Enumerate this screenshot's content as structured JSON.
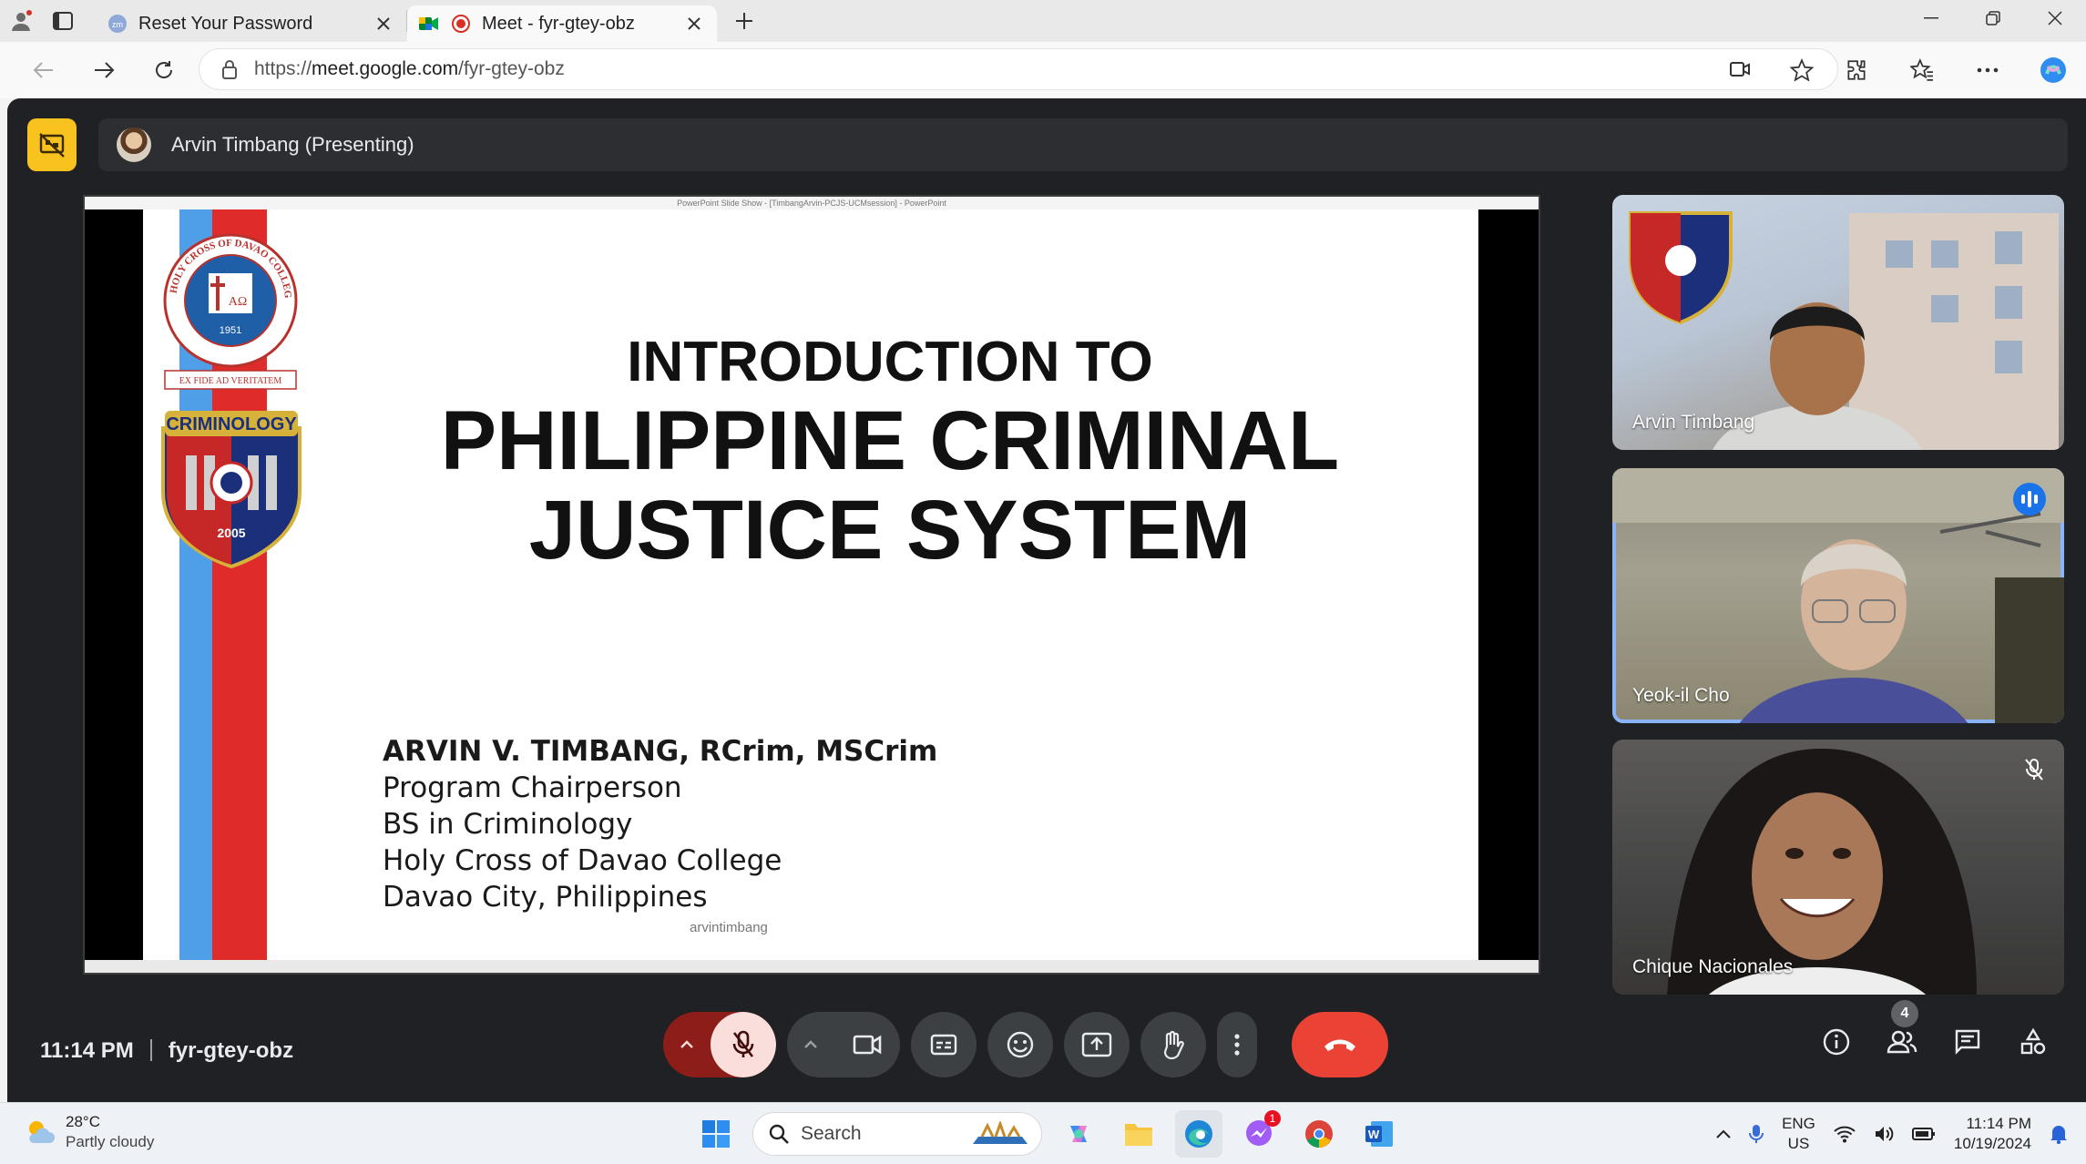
{
  "browser": {
    "tabs": [
      {
        "title": "Reset Your Password",
        "active": false
      },
      {
        "title": "Meet - fyr-gtey-obz",
        "active": true
      }
    ],
    "url_scheme": "https://",
    "url_host": "meet.google.com",
    "url_path": "/fyr-gtey-obz"
  },
  "meet": {
    "presenter_label": "Arvin Timbang (Presenting)",
    "ppt_window_title": "PowerPoint Slide Show - [TimbangArvin-PCJS-UCMsession] - PowerPoint",
    "slide": {
      "title_line1": "INTRODUCTION TO",
      "title_line2": "PHILIPPINE CRIMINAL",
      "title_line3": "JUSTICE SYSTEM",
      "author": "ARVIN V. TIMBANG, RCrim, MSCrim",
      "role": "Program Chairperson",
      "program": "BS in Criminology",
      "school": "Holy Cross of Davao College",
      "location": "Davao City, Philippines",
      "watermark": "arvintimbang",
      "seal1_text": "HOLY CROSS OF DAVAO COLLEGE, INC.",
      "seal1_year": "1951",
      "seal1_motto": "EX FIDE AD VERITATEM",
      "seal2_text": "CRIMINOLOGY",
      "seal2_year": "2005"
    },
    "participants": [
      {
        "name": "Arvin Timbang",
        "speaking": false,
        "muted": false
      },
      {
        "name": "Yeok-il Cho",
        "speaking": true,
        "muted": false
      },
      {
        "name": "Chique Nacionales",
        "speaking": false,
        "muted": true
      }
    ],
    "time": "11:14 PM",
    "meeting_code": "fyr-gtey-obz",
    "people_count": "4",
    "colors": {
      "end_call": "#ea4335",
      "present_stop": "#f8c21f",
      "speaking": "#1a73e8",
      "mic_off": "#f9dedc"
    }
  },
  "taskbar": {
    "temperature": "28°C",
    "weather": "Partly cloudy",
    "search_placeholder": "Search",
    "lang_1": "ENG",
    "lang_2": "US",
    "clock_time": "11:14 PM",
    "clock_date": "10/19/2024",
    "messenger_badge": "1"
  }
}
